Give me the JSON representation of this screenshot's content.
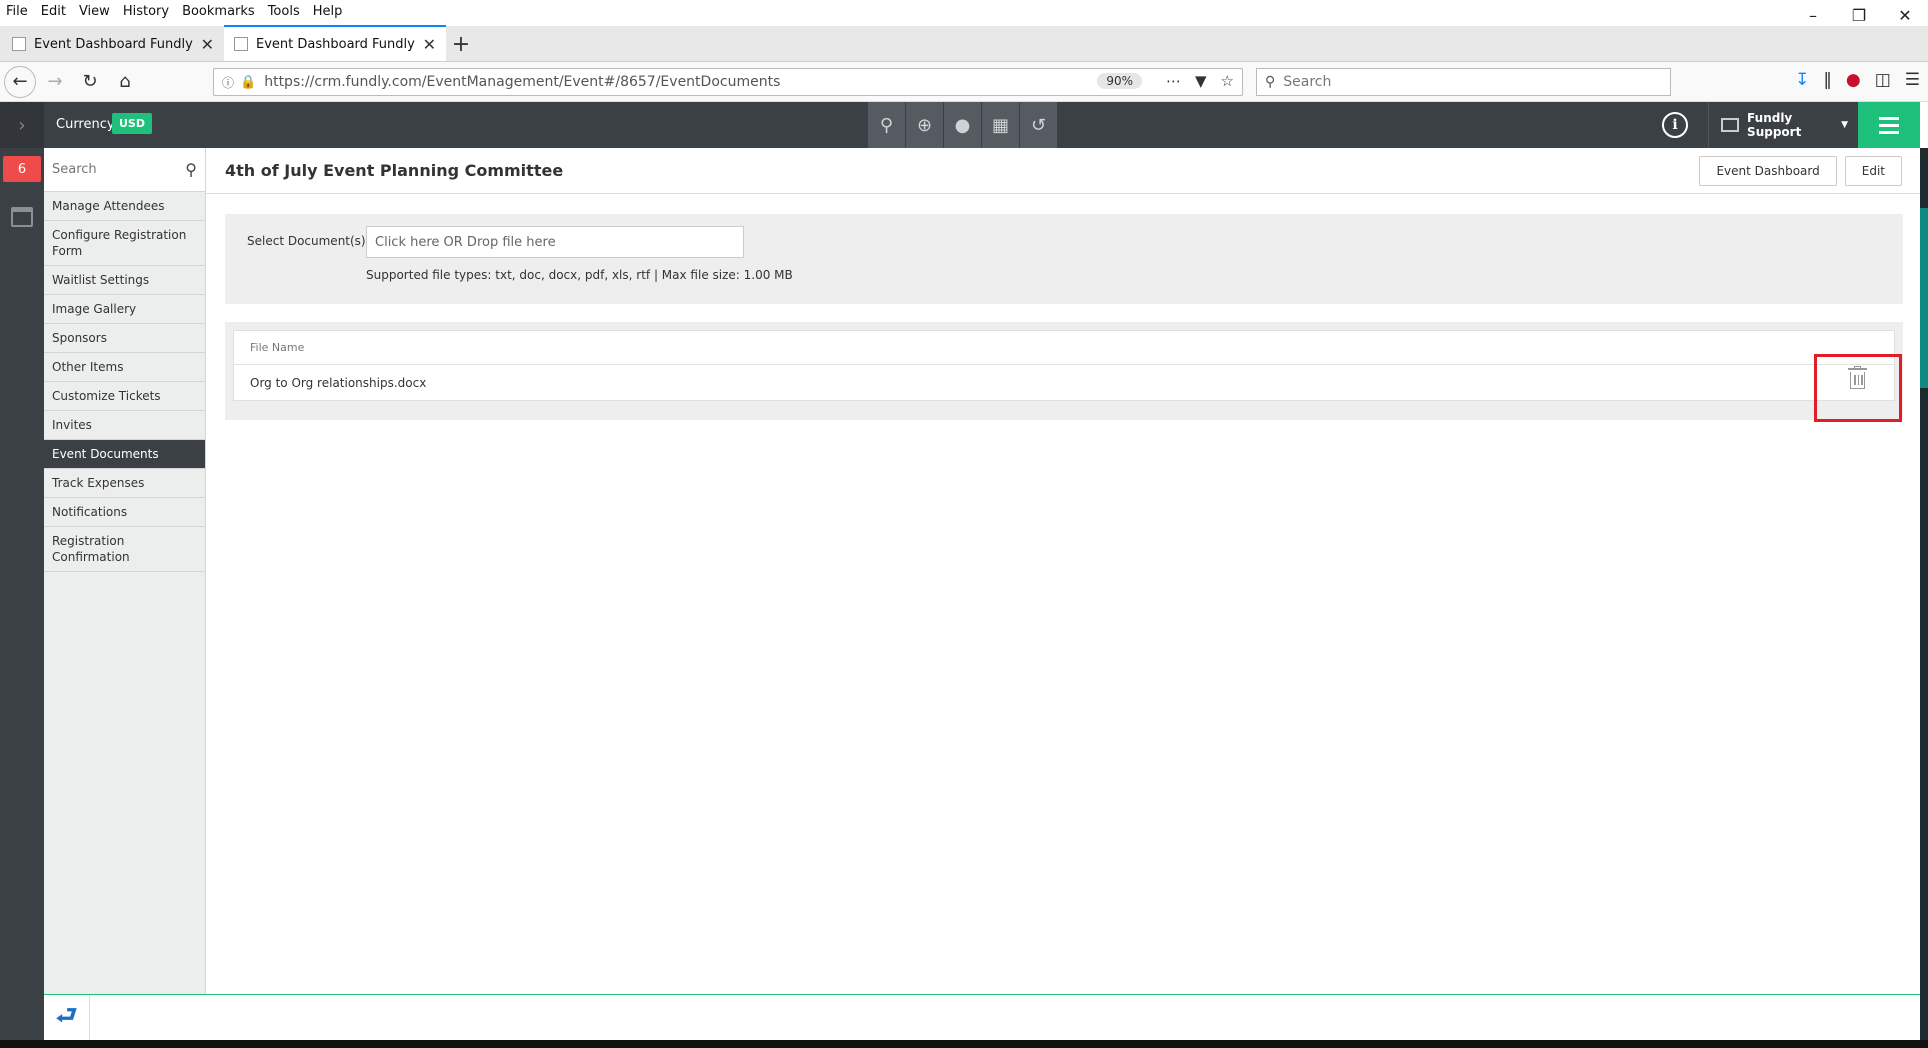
{
  "browser": {
    "menu": [
      "File",
      "Edit",
      "View",
      "History",
      "Bookmarks",
      "Tools",
      "Help"
    ],
    "tabs": [
      {
        "title": "Event Dashboard Fundly CRM",
        "active": false
      },
      {
        "title": "Event Dashboard Fundly CRM",
        "active": true
      }
    ],
    "url": "https://crm.fundly.com/EventManagement/Event#/8657/EventDocuments",
    "zoom": "90%",
    "search_placeholder": "Search"
  },
  "app": {
    "currency_label": "Currency",
    "currency_code": "USD",
    "user_name": "Fundly Support",
    "notification_count": "6",
    "toolbar_icons": [
      "search-icon",
      "add-icon",
      "user-icon",
      "organization-icon",
      "history-icon"
    ]
  },
  "sidebar": {
    "search_placeholder": "Search",
    "items": [
      {
        "label": "Manage Attendees"
      },
      {
        "label": "Configure Registration Form"
      },
      {
        "label": "Waitlist Settings"
      },
      {
        "label": "Image Gallery"
      },
      {
        "label": "Sponsors"
      },
      {
        "label": "Other Items"
      },
      {
        "label": "Customize Tickets"
      },
      {
        "label": "Invites"
      },
      {
        "label": "Event Documents",
        "active": true
      },
      {
        "label": "Track Expenses"
      },
      {
        "label": "Notifications"
      },
      {
        "label": "Registration Confirmation"
      }
    ]
  },
  "page": {
    "title": "4th of July Event Planning Committee",
    "buttons": {
      "dashboard": "Event Dashboard",
      "edit": "Edit"
    },
    "upload": {
      "label": "Select Document(s):",
      "drop_text": "Click here OR Drop file here",
      "hint": "Supported file types: txt, doc, docx, pdf, xls, rtf | Max file size: 1.00 MB"
    },
    "files": {
      "column": "File Name",
      "rows": [
        {
          "name": "Org to Org relationships.docx"
        }
      ]
    }
  },
  "colors": {
    "accent": "#1fc07c",
    "header": "#3b4045",
    "highlight": "#e11d25",
    "badge": "#f04b4b"
  }
}
